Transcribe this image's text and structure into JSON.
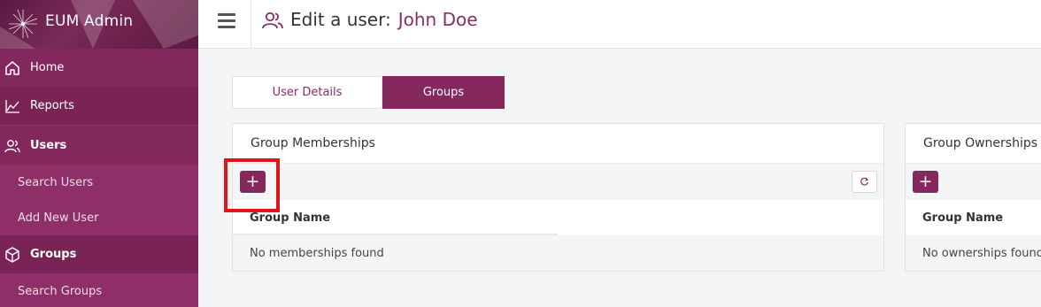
{
  "app": {
    "title": "EUM Admin"
  },
  "sidebar": {
    "items": [
      {
        "label": "Home",
        "icon": "home-icon"
      },
      {
        "label": "Reports",
        "icon": "chart-line-icon"
      },
      {
        "label": "Users",
        "icon": "users-icon"
      },
      {
        "label": "Search Users"
      },
      {
        "label": "Add New User"
      },
      {
        "label": "Groups",
        "icon": "cube-icon"
      },
      {
        "label": "Search Groups"
      }
    ]
  },
  "header": {
    "title_prefix": "Edit a user:",
    "user_name": "John Doe"
  },
  "tabs": [
    {
      "label": "User Details",
      "active": false
    },
    {
      "label": "Groups",
      "active": true
    }
  ],
  "memberships": {
    "title": "Group Memberships",
    "add_label": "+",
    "column": "Group Name",
    "empty": "No memberships found"
  },
  "ownerships": {
    "title": "Group Ownerships",
    "add_label": "+",
    "column": "Group Name",
    "empty": "No ownerships found"
  },
  "colors": {
    "brand": "#85285e",
    "highlight": "#e0151a"
  }
}
